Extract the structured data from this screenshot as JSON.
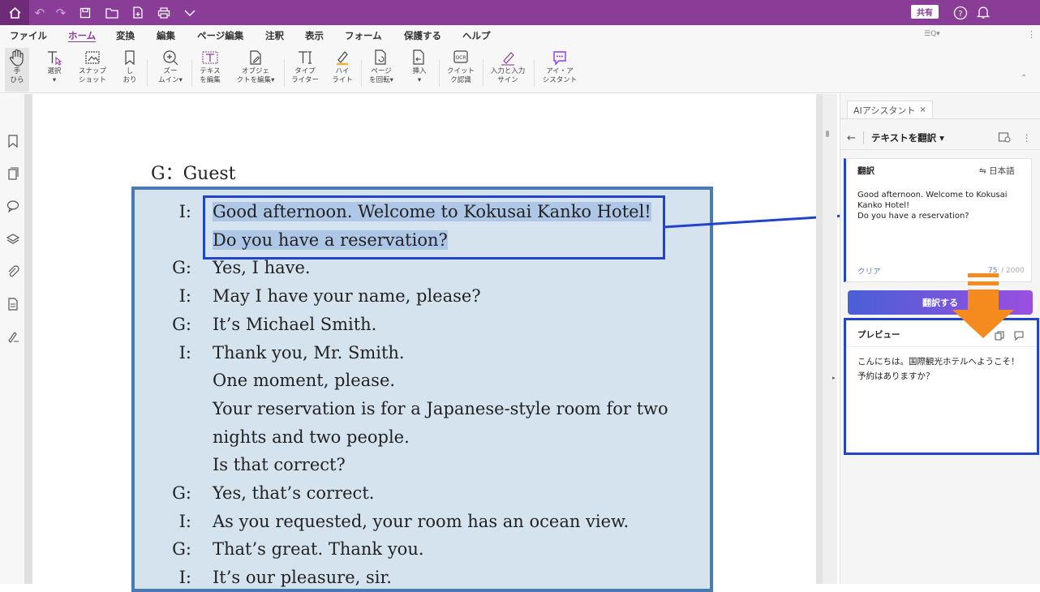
{
  "toolbar": {
    "share_label": "共有"
  },
  "menu": {
    "items": [
      "ファイル",
      "ホーム",
      "変換",
      "編集",
      "ページ編集",
      "注釈",
      "表示",
      "フォーム",
      "保護する",
      "ヘルプ"
    ],
    "search_placeholder": "検索"
  },
  "ribbon": {
    "buttons": [
      {
        "label": "手\nひら"
      },
      {
        "label": "選択\n▾"
      },
      {
        "label": "スナップ\nショット"
      },
      {
        "label": "し\nおり"
      },
      {
        "label": "ズー\nムイン▾"
      },
      {
        "label": "テキス\nを編集"
      },
      {
        "label": "オブジェ\nクトを編集▾"
      },
      {
        "label": "タイプ\nライター"
      },
      {
        "label": "ハイ\nライト"
      },
      {
        "label": "ページ\nを回転▾"
      },
      {
        "label": "挿入\n▾"
      },
      {
        "label": "クイット\nク認識"
      },
      {
        "label": "入力と入力\nサイン"
      },
      {
        "label": "アイ・ア\nシスタント"
      }
    ]
  },
  "document": {
    "guest_heading": "G：Guest",
    "dialog": [
      {
        "speaker": "I:",
        "text": "Good afternoon. Welcome to Kokusai Kanko Hotel!",
        "highlight": true
      },
      {
        "speaker": "",
        "text": "Do you have a reservation?",
        "highlight": true
      },
      {
        "speaker": "G:",
        "text": "Yes, I have."
      },
      {
        "speaker": "I:",
        "text": "May I have your name, please?"
      },
      {
        "speaker": "G:",
        "text": "It’s Michael Smith."
      },
      {
        "speaker": "I:",
        "text": "Thank you, Mr. Smith."
      },
      {
        "speaker": "",
        "text": "One moment, please."
      },
      {
        "speaker": "",
        "text": "Your reservation is for a Japanese-style room for two"
      },
      {
        "speaker": "",
        "text": "nights and two people."
      },
      {
        "speaker": "",
        "text": "Is that correct?"
      },
      {
        "speaker": "G:",
        "text": "Yes, that’s correct."
      },
      {
        "speaker": "I:",
        "text": "As you requested, your room has an ocean view."
      },
      {
        "speaker": "G:",
        "text": "That’s great. Thank you."
      },
      {
        "speaker": "I:",
        "text": "It’s our pleasure, sir."
      }
    ]
  },
  "panel": {
    "tab_label": "AIアシスタント",
    "tab_close": "×",
    "mode_label": "テキストを翻訳 ▾",
    "translate_card": {
      "title": "翻訳",
      "language": "⇋ 日本語",
      "source_text": "Good afternoon. Welcome to Kokusai Kanko Hotel!\nDo you have a reservation?",
      "clear_label": "クリア",
      "count_current": "75",
      "count_max": "/ 2000"
    },
    "translate_button": "翻訳する",
    "preview": {
      "title": "プレビュー",
      "text": "こんにちは。国際観光ホテルへようこそ！予約はありますか？"
    }
  },
  "colors": {
    "titlebar": "#8a3d96",
    "highlight_box": "#2344c8",
    "dialog_bg": "#d5e3ef",
    "arrow": "#f58a1f"
  }
}
